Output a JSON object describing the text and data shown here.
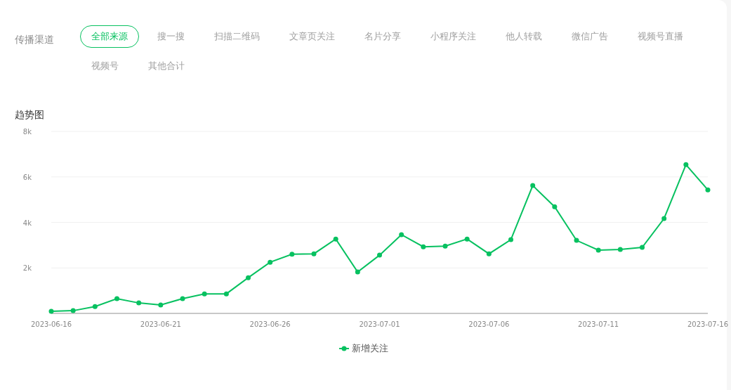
{
  "filter": {
    "label": "传播渠道",
    "items": [
      {
        "label": "全部来源",
        "selected": true
      },
      {
        "label": "搜一搜",
        "selected": false
      },
      {
        "label": "扫描二维码",
        "selected": false
      },
      {
        "label": "文章页关注",
        "selected": false
      },
      {
        "label": "名片分享",
        "selected": false
      },
      {
        "label": "小程序关注",
        "selected": false
      },
      {
        "label": "他人转载",
        "selected": false
      },
      {
        "label": "微信广告",
        "selected": false
      },
      {
        "label": "视频号直播",
        "selected": false
      },
      {
        "label": "视频号",
        "selected": false
      },
      {
        "label": "其他合计",
        "selected": false
      }
    ]
  },
  "trend": {
    "title": "趋势图",
    "chart_data": {
      "type": "line",
      "x": [
        "2023-06-16",
        "2023-06-17",
        "2023-06-18",
        "2023-06-19",
        "2023-06-20",
        "2023-06-21",
        "2023-06-22",
        "2023-06-23",
        "2023-06-24",
        "2023-06-25",
        "2023-06-26",
        "2023-06-27",
        "2023-06-28",
        "2023-06-29",
        "2023-06-30",
        "2023-07-01",
        "2023-07-02",
        "2023-07-03",
        "2023-07-04",
        "2023-07-05",
        "2023-07-06",
        "2023-07-07",
        "2023-07-08",
        "2023-07-09",
        "2023-07-10",
        "2023-07-11",
        "2023-07-12",
        "2023-07-13",
        "2023-07-14",
        "2023-07-15",
        "2023-07-16"
      ],
      "series": [
        {
          "name": "新增关注",
          "color": "#07c160",
          "marker": "circle",
          "values": [
            90,
            120,
            300,
            650,
            460,
            370,
            650,
            860,
            860,
            1570,
            2250,
            2600,
            2620,
            3270,
            1820,
            2560,
            3460,
            2930,
            2960,
            3270,
            2620,
            3240,
            5620,
            4690,
            3210,
            2780,
            2810,
            2900,
            4170,
            6540,
            5430
          ]
        }
      ],
      "xlim": [
        "2023-06-16",
        "2023-07-16"
      ],
      "grid": true,
      "ylim": [
        0,
        8000
      ],
      "yticks": [
        {
          "value": 2000,
          "label": "2k"
        },
        {
          "value": 4000,
          "label": "4k"
        },
        {
          "value": 6000,
          "label": "6k"
        },
        {
          "value": 8000,
          "label": "8k"
        }
      ],
      "xticks": [
        "2023-06-16",
        "2023-06-21",
        "2023-06-26",
        "2023-07-01",
        "2023-07-06",
        "2023-07-11",
        "2023-07-16"
      ]
    }
  }
}
